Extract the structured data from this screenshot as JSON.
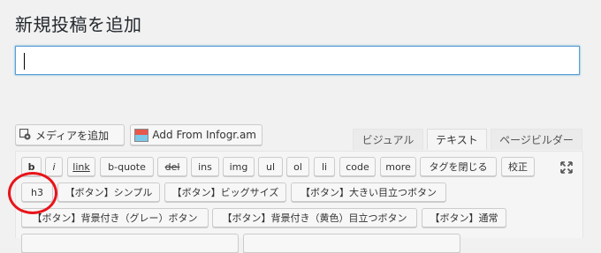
{
  "page": {
    "title": "新規投稿を追加"
  },
  "title_input": {
    "value": ""
  },
  "media_buttons": {
    "add_media": {
      "label": "メディアを追加",
      "icon": "media-icon"
    },
    "add_infogram": {
      "label": "Add From Infogr.am",
      "icon": "infogram-icon"
    }
  },
  "editor_tabs": [
    {
      "label": "ビジュアル"
    },
    {
      "label": "テキスト",
      "active": true
    },
    {
      "label": "ページビルダー"
    }
  ],
  "quicktags": {
    "row1": [
      {
        "label": "b"
      },
      {
        "label": "i"
      },
      {
        "label": "link"
      },
      {
        "label": "b-quote"
      },
      {
        "label": "del"
      },
      {
        "label": "ins"
      },
      {
        "label": "img"
      },
      {
        "label": "ul"
      },
      {
        "label": "ol"
      },
      {
        "label": "li"
      },
      {
        "label": "code"
      },
      {
        "label": "more"
      },
      {
        "label": "タグを閉じる"
      },
      {
        "label": "校正"
      }
    ],
    "row2": [
      {
        "label": "h3"
      },
      {
        "label": "【ボタン】シンプル"
      },
      {
        "label": "【ボタン】ビッグサイズ"
      },
      {
        "label": "【ボタン】大きい目立つボタン"
      }
    ],
    "row3": [
      {
        "label": "【ボタン】背景付き（グレー）ボタン"
      },
      {
        "label": "【ボタン】背景付き（黄色）目立つボタン"
      },
      {
        "label": "【ボタン】通常"
      }
    ],
    "fullscreen_icon": "fullscreen-icon"
  },
  "annotation": {
    "color": "#e8141a"
  },
  "colors": {
    "focus_border": "#5b9dd9",
    "background": "#f1f1f1"
  }
}
